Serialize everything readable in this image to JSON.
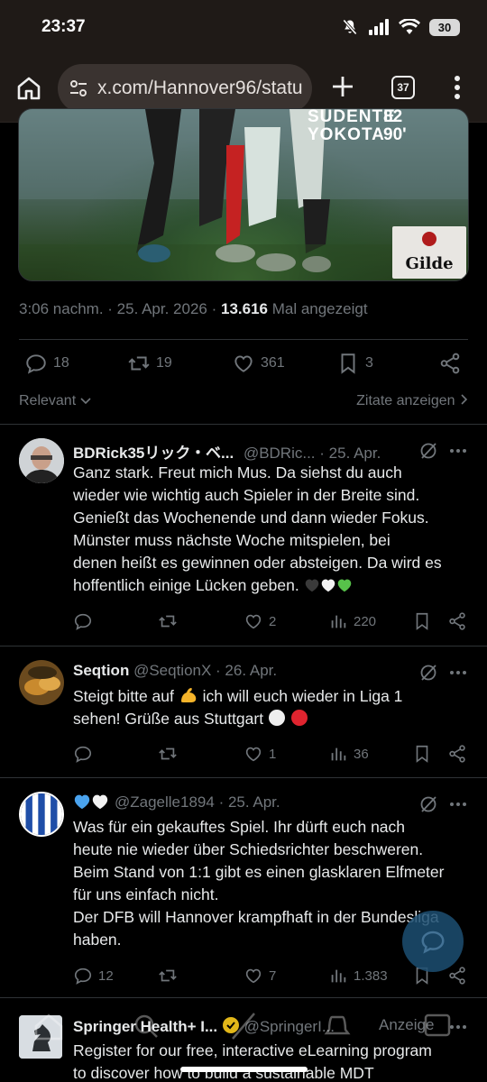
{
  "status_bar": {
    "time": "23:37",
    "battery": "30"
  },
  "browser": {
    "url": "x.com/Hannover96/statu",
    "tab_count": "37"
  },
  "media": {
    "caption_name_top": "SUDENTE",
    "caption_name": "YOKOTA",
    "caption_number_top": "82",
    "caption_minute": "90'",
    "sponsor": "Gilde"
  },
  "tweet_meta": {
    "time_date": "3:06 nachm. · 25. Apr. 2026 · ",
    "views": "13.616",
    "views_label": " Mal angezeigt"
  },
  "tweet_actions": {
    "replies": "18",
    "reposts": "19",
    "likes": "361",
    "bookmarks": "3"
  },
  "filter": {
    "left": "Relevant",
    "right": "Zitate anzeigen"
  },
  "replies": [
    {
      "name": "BDRick35リック・ベ...",
      "handle": "@BDRic...",
      "date": " · 25. Apr.",
      "text": "Ganz stark. Freut mich Mus. Da siehst du auch\nwieder wie wichtig auch Spieler in der Breite sind.\nGenießt das Wochenende und dann wieder Fokus.\nMünster muss nächste Woche mitspielen, bei\ndenen heißt es gewinnen oder absteigen. Da wird es\nhoffentlich einige Lücken geben. ",
      "likes": "2",
      "views": "220"
    },
    {
      "name": "Seqtion",
      "handle": " @SeqtionX",
      "date": " · 26. Apr.",
      "text_a": "Steigt bitte auf ",
      "text_b": " ich will euch wieder in Liga 1\nsehen! Grüße aus Stuttgart ",
      "likes": "1",
      "views": "36"
    },
    {
      "handle": "@Zagelle1894",
      "date": " · 25. Apr.",
      "text": "Was für ein gekauftes Spiel. Ihr dürft euch nach\nheute nie wieder über Schiedsrichter beschweren.\nBeim Stand von 1:1 gibt es einen glasklaren Elfmeter\nfür uns einfach nicht.\nDer DFB will Hannover krampfhaft in der Bundesliga\nhaben.",
      "replies": "12",
      "likes": "7",
      "views": "1.383"
    }
  ],
  "ad": {
    "name": "Springer Health+ I...",
    "handle": " @SpringerI...",
    "label": "Anzeige",
    "text": "Register for our free, interactive eLearning program\nto discover how to build a sustainable MDT"
  },
  "colors": {
    "background": "#000000",
    "text": "#e7e9ea",
    "muted": "#71767b",
    "accent": "#1d9bf0",
    "browser_bar": "#1f1a17"
  }
}
